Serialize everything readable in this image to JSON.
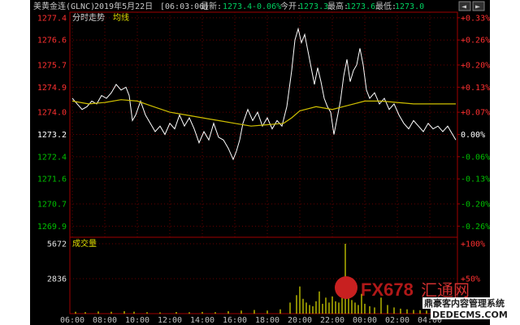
{
  "header": {
    "symbol": "美黄金连(GLNC)",
    "date": "2019年5月22日",
    "time": "[06:03:06]",
    "latest_label": "最新:",
    "latest_value": "1273.4",
    "change_value": "-0.06%",
    "open_label": "今开:",
    "open_value": "1273.3",
    "high_label": "最高:",
    "high_value": "1273.6",
    "low_label": "最低:",
    "low_value": "1273.0"
  },
  "top_buttons": [
    "◄",
    "►"
  ],
  "panel_labels": {
    "price_tab": "分时走势",
    "avg_tab": "均线",
    "volume_tab": "成交量"
  },
  "watermark": {
    "brand": "FX678",
    "line1": "汇通网",
    "line2": "鼎豪客内容管理系统",
    "line3": "DEDECMS.COM"
  },
  "colors": {
    "background": "#000000",
    "panel_border": "#a00000",
    "price_line": "#ffffff",
    "avg_line": "#d0c000",
    "volume_bar": "#e0e000",
    "up_text": "#ff3030",
    "down_text": "#00c000",
    "ref_text": "#ffffff",
    "watermark_red": "#e02020"
  },
  "chart_data": [
    {
      "type": "line",
      "title": "分时走势",
      "x_ticks": [
        "06:00",
        "08:00",
        "10:00",
        "12:00",
        "14:00",
        "16:00",
        "18:00",
        "20:00",
        "22:00",
        "00:00",
        "02:00",
        "04:00"
      ],
      "y_ticks_left": [
        1277.4,
        1276.6,
        1275.7,
        1274.9,
        1274.0,
        1273.2,
        1272.4,
        1271.6,
        1270.7,
        1269.9
      ],
      "y_ticks_right": [
        "+0.33%",
        "+0.26%",
        "+0.20%",
        "+0.13%",
        "+0.07%",
        "0.00%",
        "-0.06%",
        "-0.13%",
        "-0.20%",
        "-0.26%"
      ],
      "reference_price": 1273.2,
      "ylim": [
        1269.5,
        1277.6
      ],
      "xlim_hours": [
        6,
        29.6
      ],
      "series": [
        {
          "name": "price",
          "points": [
            [
              6.0,
              1274.5
            ],
            [
              6.3,
              1274.3
            ],
            [
              6.6,
              1274.1
            ],
            [
              6.9,
              1274.2
            ],
            [
              7.2,
              1274.4
            ],
            [
              7.5,
              1274.3
            ],
            [
              7.8,
              1274.6
            ],
            [
              8.1,
              1274.5
            ],
            [
              8.4,
              1274.7
            ],
            [
              8.7,
              1275.0
            ],
            [
              9.0,
              1274.8
            ],
            [
              9.3,
              1274.9
            ],
            [
              9.5,
              1274.6
            ],
            [
              9.7,
              1273.7
            ],
            [
              9.9,
              1273.9
            ],
            [
              10.2,
              1274.4
            ],
            [
              10.5,
              1273.9
            ],
            [
              10.8,
              1273.6
            ],
            [
              11.1,
              1273.3
            ],
            [
              11.4,
              1273.5
            ],
            [
              11.7,
              1273.2
            ],
            [
              12.0,
              1273.6
            ],
            [
              12.3,
              1273.4
            ],
            [
              12.6,
              1273.9
            ],
            [
              12.9,
              1273.5
            ],
            [
              13.2,
              1273.8
            ],
            [
              13.5,
              1273.4
            ],
            [
              13.8,
              1272.9
            ],
            [
              14.1,
              1273.3
            ],
            [
              14.4,
              1273.0
            ],
            [
              14.7,
              1273.6
            ],
            [
              15.0,
              1273.1
            ],
            [
              15.3,
              1273.0
            ],
            [
              15.6,
              1272.7
            ],
            [
              15.9,
              1272.3
            ],
            [
              16.1,
              1272.6
            ],
            [
              16.3,
              1273.0
            ],
            [
              16.5,
              1273.6
            ],
            [
              16.8,
              1274.1
            ],
            [
              17.1,
              1273.7
            ],
            [
              17.4,
              1274.0
            ],
            [
              17.7,
              1273.5
            ],
            [
              18.0,
              1273.8
            ],
            [
              18.3,
              1273.4
            ],
            [
              18.6,
              1273.7
            ],
            [
              18.9,
              1273.5
            ],
            [
              19.2,
              1274.2
            ],
            [
              19.5,
              1275.5
            ],
            [
              19.7,
              1276.6
            ],
            [
              19.9,
              1277.0
            ],
            [
              20.1,
              1276.5
            ],
            [
              20.3,
              1276.8
            ],
            [
              20.5,
              1276.2
            ],
            [
              20.7,
              1275.6
            ],
            [
              20.9,
              1275.0
            ],
            [
              21.1,
              1275.6
            ],
            [
              21.3,
              1275.1
            ],
            [
              21.5,
              1274.5
            ],
            [
              21.7,
              1274.2
            ],
            [
              21.9,
              1274.0
            ],
            [
              22.1,
              1273.2
            ],
            [
              22.3,
              1273.8
            ],
            [
              22.5,
              1274.4
            ],
            [
              22.7,
              1275.3
            ],
            [
              22.9,
              1275.9
            ],
            [
              23.1,
              1275.1
            ],
            [
              23.3,
              1275.5
            ],
            [
              23.5,
              1275.7
            ],
            [
              23.7,
              1276.3
            ],
            [
              23.9,
              1275.7
            ],
            [
              24.1,
              1274.8
            ],
            [
              24.3,
              1274.5
            ],
            [
              24.6,
              1274.7
            ],
            [
              24.9,
              1274.3
            ],
            [
              25.2,
              1274.5
            ],
            [
              25.5,
              1274.1
            ],
            [
              25.8,
              1274.3
            ],
            [
              26.1,
              1273.9
            ],
            [
              26.4,
              1273.6
            ],
            [
              26.7,
              1273.4
            ],
            [
              27.0,
              1273.7
            ],
            [
              27.3,
              1273.5
            ],
            [
              27.6,
              1273.3
            ],
            [
              27.9,
              1273.6
            ],
            [
              28.2,
              1273.4
            ],
            [
              28.5,
              1273.5
            ],
            [
              28.8,
              1273.3
            ],
            [
              29.1,
              1273.5
            ],
            [
              29.4,
              1273.2
            ],
            [
              29.6,
              1273.0
            ]
          ]
        },
        {
          "name": "average",
          "points": [
            [
              6.0,
              1274.4
            ],
            [
              7.0,
              1274.3
            ],
            [
              8.0,
              1274.35
            ],
            [
              9.0,
              1274.45
            ],
            [
              10.0,
              1274.4
            ],
            [
              11.0,
              1274.2
            ],
            [
              12.0,
              1274.0
            ],
            [
              13.0,
              1273.9
            ],
            [
              14.0,
              1273.8
            ],
            [
              15.0,
              1273.7
            ],
            [
              16.0,
              1273.6
            ],
            [
              17.0,
              1273.5
            ],
            [
              18.0,
              1273.55
            ],
            [
              19.0,
              1273.6
            ],
            [
              19.5,
              1273.8
            ],
            [
              20.0,
              1274.05
            ],
            [
              21.0,
              1274.2
            ],
            [
              22.0,
              1274.1
            ],
            [
              23.0,
              1274.25
            ],
            [
              24.0,
              1274.4
            ],
            [
              25.0,
              1274.4
            ],
            [
              26.0,
              1274.35
            ],
            [
              27.0,
              1274.3
            ],
            [
              28.0,
              1274.3
            ],
            [
              29.0,
              1274.3
            ],
            [
              29.6,
              1274.3
            ]
          ]
        }
      ]
    },
    {
      "type": "bar",
      "title": "成交量",
      "y_ticks_left": [
        5672,
        2836
      ],
      "y_ticks_right": [
        "+100%",
        "+50%"
      ],
      "ylim": [
        0,
        5672
      ],
      "values_by_hour": [
        [
          6.2,
          150
        ],
        [
          6.8,
          120
        ],
        [
          7.6,
          180
        ],
        [
          8.4,
          150
        ],
        [
          9.2,
          200
        ],
        [
          9.8,
          160
        ],
        [
          10.6,
          120
        ],
        [
          11.4,
          100
        ],
        [
          12.4,
          130
        ],
        [
          13.2,
          110
        ],
        [
          14.0,
          140
        ],
        [
          14.8,
          120
        ],
        [
          15.6,
          200
        ],
        [
          16.4,
          250
        ],
        [
          17.2,
          300
        ],
        [
          18.0,
          250
        ],
        [
          18.8,
          350
        ],
        [
          19.4,
          900
        ],
        [
          19.8,
          1500
        ],
        [
          20.0,
          2200
        ],
        [
          20.2,
          1200
        ],
        [
          20.4,
          900
        ],
        [
          20.6,
          700
        ],
        [
          20.8,
          600
        ],
        [
          21.0,
          1000
        ],
        [
          21.2,
          1800
        ],
        [
          21.4,
          800
        ],
        [
          21.6,
          1300
        ],
        [
          21.8,
          900
        ],
        [
          22.0,
          1400
        ],
        [
          22.2,
          1000
        ],
        [
          22.4,
          900
        ],
        [
          22.6,
          1800
        ],
        [
          22.8,
          5672
        ],
        [
          23.0,
          1500
        ],
        [
          23.2,
          1100
        ],
        [
          23.4,
          900
        ],
        [
          23.6,
          700
        ],
        [
          23.8,
          1600
        ],
        [
          24.0,
          800
        ],
        [
          24.3,
          600
        ],
        [
          24.6,
          500
        ],
        [
          25.0,
          1300
        ],
        [
          25.4,
          700
        ],
        [
          25.8,
          500
        ],
        [
          26.2,
          400
        ],
        [
          26.6,
          350
        ],
        [
          27.0,
          300
        ],
        [
          27.4,
          280
        ],
        [
          27.8,
          250
        ],
        [
          28.2,
          220
        ],
        [
          28.6,
          200
        ],
        [
          29.0,
          180
        ],
        [
          29.4,
          160
        ]
      ]
    }
  ]
}
